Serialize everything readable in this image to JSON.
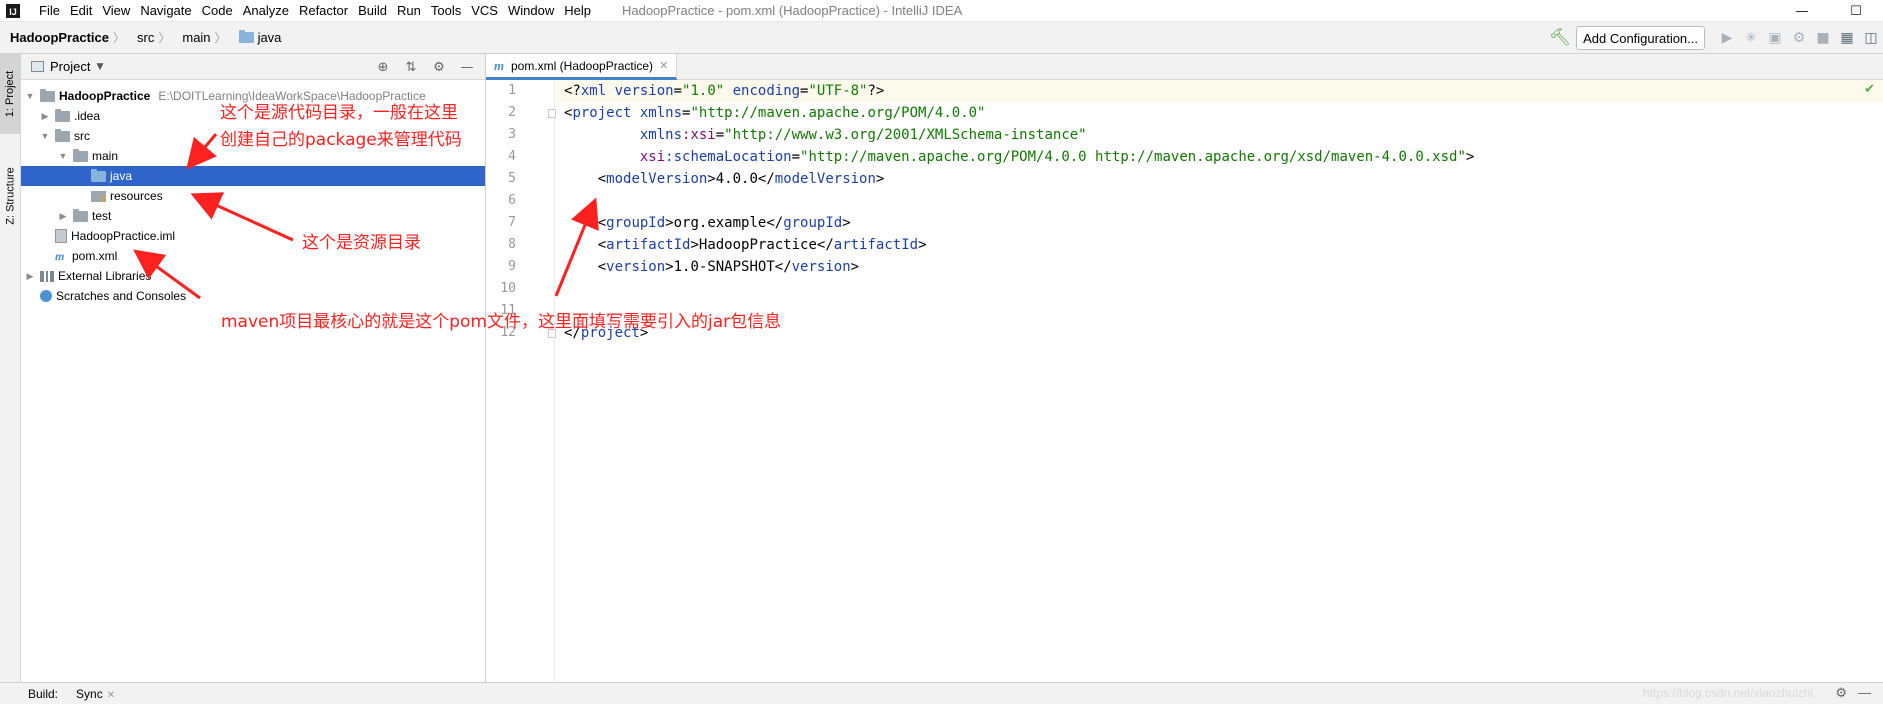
{
  "window": {
    "app_icon": "intellij-idea-logo",
    "title": "HadoopPractice - pom.xml (HadoopPractice) - IntelliJ IDEA",
    "controls": [
      "minimize",
      "maximize"
    ]
  },
  "menu": [
    "File",
    "Edit",
    "View",
    "Navigate",
    "Code",
    "Analyze",
    "Refactor",
    "Build",
    "Run",
    "Tools",
    "VCS",
    "Window",
    "Help"
  ],
  "breadcrumbs": [
    "HadoopPractice",
    "src",
    "main",
    "java"
  ],
  "toolbar": {
    "add_config_label": "Add Configuration..."
  },
  "left_strip": {
    "project_tab": "1: Project",
    "structure_tab": "Z: Structure"
  },
  "project_panel": {
    "title": "Project",
    "tree": [
      {
        "label": "HadoopPractice",
        "hint": "E:\\DOITLearning\\IdeaWorkSpace\\HadoopPractice",
        "icon": "module-folder-icon"
      },
      {
        "label": ".idea",
        "icon": "folder-icon"
      },
      {
        "label": "src",
        "icon": "folder-icon"
      },
      {
        "label": "main",
        "icon": "folder-icon"
      },
      {
        "label": "java",
        "icon": "source-folder-icon",
        "selected": true
      },
      {
        "label": "resources",
        "icon": "resources-folder-icon"
      },
      {
        "label": "test",
        "icon": "folder-icon"
      },
      {
        "label": "HadoopPractice.iml",
        "icon": "iml-file-icon"
      },
      {
        "label": "pom.xml",
        "icon": "maven-file-icon"
      },
      {
        "label": "External Libraries",
        "icon": "library-icon"
      },
      {
        "label": "Scratches and Consoles",
        "icon": "scratches-icon"
      }
    ]
  },
  "annotations": {
    "source_dir_line1": "这个是源代码目录，一般在这里",
    "source_dir_line2": "创建自己的package来管理代码",
    "resource_dir": "这个是资源目录",
    "pom_note": "maven项目最核心的就是这个pom文件，这里面填写需要引入的jar包信息"
  },
  "editor": {
    "tab_label": "pom.xml (HadoopPractice)",
    "line_numbers": [
      "1",
      "2",
      "3",
      "4",
      "5",
      "6",
      "7",
      "8",
      "9",
      "10",
      "11",
      "12"
    ],
    "code": {
      "l1_a": "<?",
      "l1_b": "xml",
      "l1_c": " version",
      "l1_d": "=",
      "l1_e": "\"1.0\"",
      "l1_f": " encoding",
      "l1_g": "=",
      "l1_h": "\"UTF-8\"",
      "l1_i": "?>",
      "l2_a": "<",
      "l2_b": "project",
      "l2_c": " xmlns",
      "l2_d": "=",
      "l2_e": "\"http://maven.apache.org/POM/4.0.0\"",
      "l3_a": "         xmlns",
      "l3_b": ":xsi",
      "l3_c": "=",
      "l3_d": "\"http://www.w3.org/2001/XMLSchema-instance\"",
      "l4_a": "         xsi",
      "l4_b": ":schemaLocation",
      "l4_c": "=",
      "l4_d": "\"http://maven.apache.org/POM/4.0.0 http://maven.apache.org/xsd/maven-4.0.0.xsd\"",
      "l4_e": ">",
      "l5_tag": "modelVersion",
      "l5_val": "4.0.0",
      "l7_tag": "groupId",
      "l7_val": "org.example",
      "l8_tag": "artifactId",
      "l8_val": "HadoopPractice",
      "l9_tag": "version",
      "l9_val": "1.0-SNAPSHOT",
      "l12_tag": "project"
    }
  },
  "bottom": {
    "build_label": "Build:",
    "sync_label": "Sync",
    "watermark": "https://blog.csdn.net/xiaozhuizhi"
  }
}
